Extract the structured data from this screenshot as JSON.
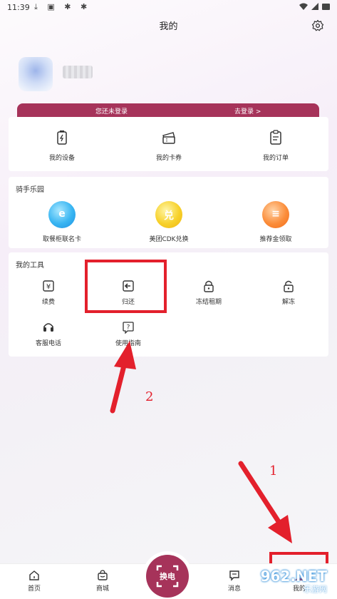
{
  "status_bar": {
    "time": "11:39",
    "icons": [
      "download-icon",
      "image-icon",
      "bug-icon",
      "bug-icon"
    ],
    "right_icons": [
      "wifi-icon",
      "signal-icon",
      "battery-icon"
    ]
  },
  "header": {
    "title": "我的"
  },
  "login_bar": {
    "tip": "您还未登录",
    "link": "去登录 >"
  },
  "quick_actions": [
    {
      "label": "我的设备",
      "icon": "battery-device-icon"
    },
    {
      "label": "我的卡券",
      "icon": "ticket-icon"
    },
    {
      "label": "我的订单",
      "icon": "order-icon"
    }
  ],
  "rider_park": {
    "title": "骑手乐园",
    "items": [
      {
        "label": "取餐柜联名卡",
        "icon": "e-bubble-icon",
        "glyph": "e"
      },
      {
        "label": "美团CDK兑换",
        "icon": "exchange-bubble-icon",
        "glyph": "兑"
      },
      {
        "label": "推荐金领取",
        "icon": "coins-bubble-icon",
        "glyph": "≡"
      }
    ]
  },
  "tools": {
    "title": "我的工具",
    "items": [
      {
        "label": "续费",
        "icon": "yen-icon"
      },
      {
        "label": "归还",
        "icon": "return-icon"
      },
      {
        "label": "冻结租期",
        "icon": "lock-icon"
      },
      {
        "label": "解冻",
        "icon": "unlock-icon"
      },
      {
        "label": "客服电话",
        "icon": "headset-icon"
      },
      {
        "label": "使用指南",
        "icon": "help-icon"
      }
    ]
  },
  "annotations": {
    "step1": "1",
    "step2": "2"
  },
  "bottom_nav": {
    "home": "首页",
    "mall": "商城",
    "swap": "换电",
    "messages": "消息",
    "mine": "我的"
  },
  "watermark": {
    "main": "962.NET",
    "sub": "乐游网"
  },
  "colors": {
    "brand": "#a6335a",
    "annotation_red": "#e3202c"
  }
}
